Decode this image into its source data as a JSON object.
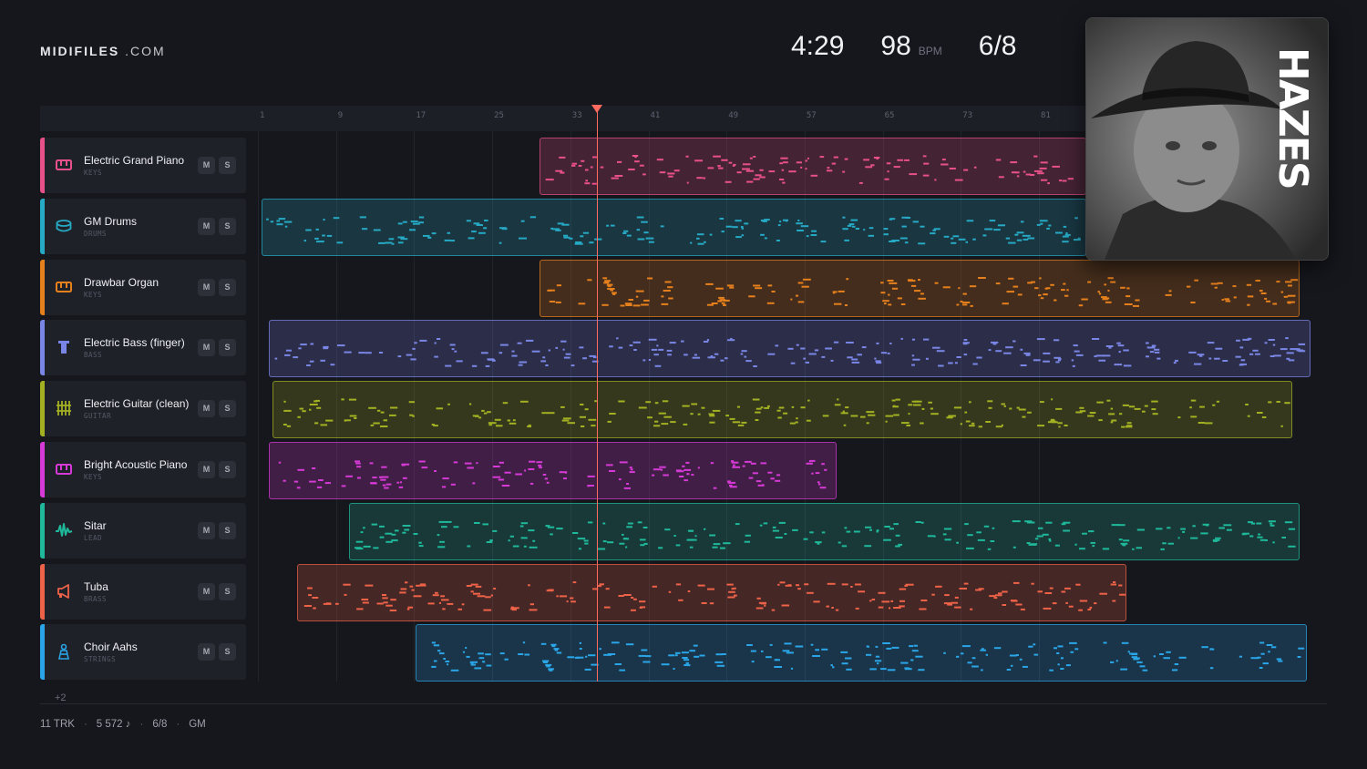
{
  "brand": {
    "name": "MIDIFILES",
    "suffix": ".COM"
  },
  "stats": {
    "duration": "4:29",
    "tempo": "98",
    "tempo_unit": "BPM",
    "time_signature": "6/8"
  },
  "cover": {
    "artist": "HAZES"
  },
  "ruler": {
    "ticks": [
      "1",
      "9",
      "17",
      "25",
      "33",
      "41",
      "49",
      "57",
      "65",
      "73",
      "81"
    ]
  },
  "tracks": [
    {
      "name": "Electric Grand Piano",
      "category": "KEYS",
      "icon": "piano-keys-icon",
      "color": "#e8508a",
      "mute": "M",
      "solo": "S"
    },
    {
      "name": "GM Drums",
      "category": "DRUMS",
      "icon": "drum-icon",
      "color": "#26a9c4",
      "mute": "M",
      "solo": "S"
    },
    {
      "name": "Drawbar Organ",
      "category": "KEYS",
      "icon": "piano-keys-icon",
      "color": "#e6801c",
      "mute": "M",
      "solo": "S"
    },
    {
      "name": "Electric Bass (finger)",
      "category": "BASS",
      "icon": "bass-icon",
      "color": "#7a86e6",
      "mute": "M",
      "solo": "S"
    },
    {
      "name": "Electric Guitar (clean)",
      "category": "GUITAR",
      "icon": "guitar-icon",
      "color": "#a2b022",
      "mute": "M",
      "solo": "S"
    },
    {
      "name": "Bright Acoustic Piano",
      "category": "KEYS",
      "icon": "piano-keys-icon",
      "color": "#d63ad6",
      "mute": "M",
      "solo": "S"
    },
    {
      "name": "Sitar",
      "category": "LEAD",
      "icon": "waveform-icon",
      "color": "#1fb89a",
      "mute": "M",
      "solo": "S"
    },
    {
      "name": "Tuba",
      "category": "BRASS",
      "icon": "horn-icon",
      "color": "#ee6248",
      "mute": "M",
      "solo": "S"
    },
    {
      "name": "Choir Aahs",
      "category": "STRINGS",
      "icon": "choir-icon",
      "color": "#2aa6e8",
      "mute": "M",
      "solo": "S"
    }
  ],
  "more_tracks": "+2",
  "footer": {
    "tracks": "11 TRK",
    "notes": "5 572 ♪",
    "time_signature": "6/8",
    "standard": "GM"
  }
}
